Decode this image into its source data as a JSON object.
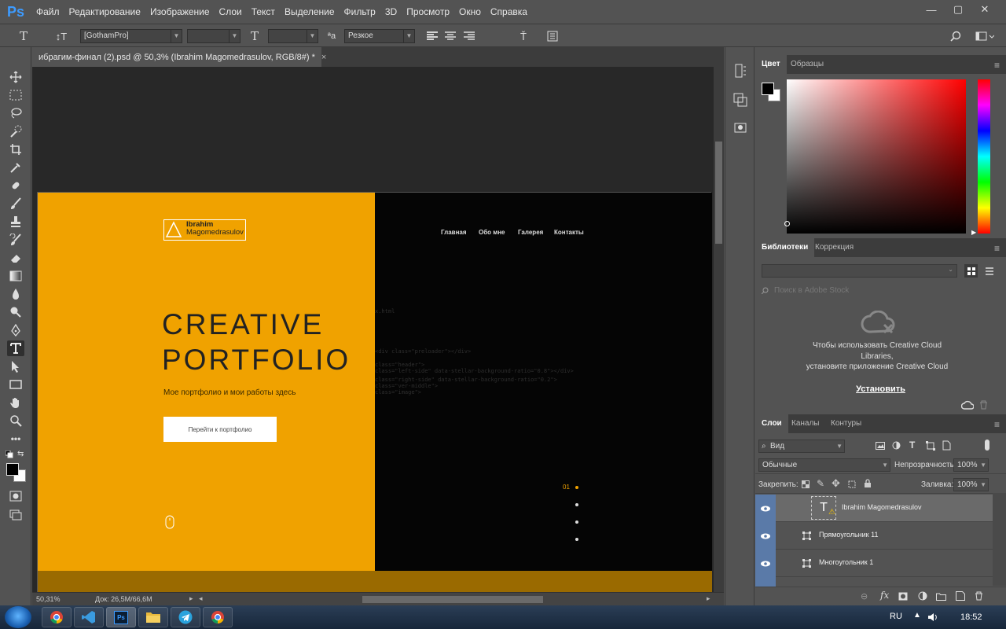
{
  "app": {
    "logo": "Ps"
  },
  "menu": [
    "Файл",
    "Редактирование",
    "Изображение",
    "Слои",
    "Текст",
    "Выделение",
    "Фильтр",
    "3D",
    "Просмотр",
    "Окно",
    "Справка"
  ],
  "window_controls": {
    "minimize": "—",
    "maximize": "▢",
    "close": "✕"
  },
  "options_bar": {
    "font_family": "[GothamPro]",
    "antialias": "Резкое",
    "text_color": "#000000"
  },
  "document": {
    "tab_title": "ибрагим-финал (2).psd @ 50,3% (Ibrahim  Magomedrasulov, RGB/8#) *",
    "close": "×"
  },
  "artwork": {
    "logo_line1": "Ibrahim",
    "logo_line2": "Magomedrasulov",
    "nav": [
      "Главная",
      "Обо мне",
      "Галерея",
      "Контакты"
    ],
    "hero_line1": "CREATIVE",
    "hero_line2": "PORTFOLIO",
    "hero_sub": "Мое портфолио и мои работы здесь",
    "hero_button": "Перейти к портфолио",
    "slide_number": "01",
    "code_lines": [
      "x.html",
      "<div class=\"preloader\"></div>",
      "class=\"header\">",
      "class=\"left-side\" data-stellar-background-ratio=\"0.8\"></div>",
      "class=\"right-side\" data-stellar-background-ratio=\"0.2\">",
      "class=\"ver-middle\">",
      "class=\"image\">"
    ],
    "accent_color": "#f0a200"
  },
  "status": {
    "zoom": "50,31%",
    "doc_info": "Док: 26,5M/66,6M"
  },
  "color_panel": {
    "tabs": [
      "Цвет",
      "Образцы"
    ]
  },
  "libraries_panel": {
    "tabs": [
      "Библиотеки",
      "Коррекция"
    ],
    "search_placeholder": "Поиск в Adobe Stock",
    "message_line1": "Чтобы использовать Creative Cloud",
    "message_line2": "Libraries,",
    "message_line3": "установите приложение Creative Cloud",
    "install_link": "Установить"
  },
  "layers_panel": {
    "tabs": [
      "Слои",
      "Каналы",
      "Контуры"
    ],
    "filter_kind": "Вид",
    "blend_mode": "Обычные",
    "opacity_label": "Непрозрачность:",
    "opacity_value": "100%",
    "lock_label": "Закрепить:",
    "fill_label": "Заливка:",
    "fill_value": "100%",
    "layers": [
      {
        "name": "Ibrahim  Magomedrasulov",
        "type": "text",
        "selected": true
      },
      {
        "name": "Прямоугольник 11",
        "type": "shape",
        "selected": false
      },
      {
        "name": "Многоугольник 1",
        "type": "shape",
        "selected": false
      }
    ]
  },
  "taskbar": {
    "language": "RU",
    "clock": "18:52"
  }
}
